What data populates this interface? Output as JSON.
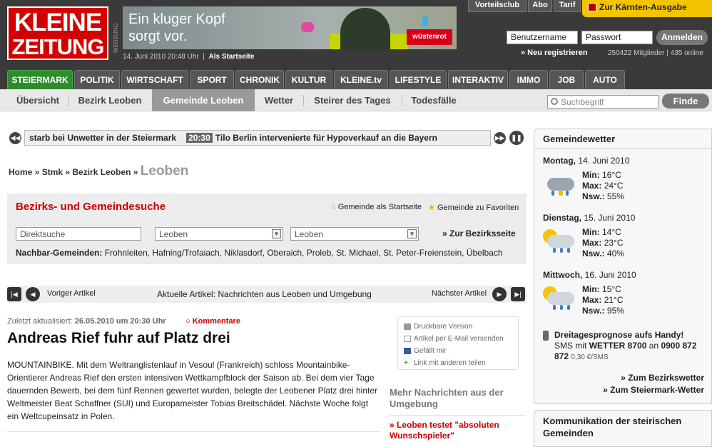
{
  "header": {
    "logo": [
      "KLEINE",
      "ZEITUNG"
    ],
    "werbung": "WERBUNG",
    "banner": {
      "line1": "Ein kluger Kopf",
      "line2": "sorgt vor.",
      "brand": "wüstenrot"
    },
    "date": "14. Juni 2010 20:48 Uhr",
    "startpage": "Als Startseite",
    "top_links": [
      "Vorteilsclub",
      "Abo",
      "Tarif"
    ],
    "kaernten": "Zur Kärnten-Ausgabe",
    "username_placeholder": "Benutzername",
    "password_placeholder": "Passwort",
    "login_button": "Anmelden",
    "register": "» Neu registrieren",
    "members": "250422 Mitglieder | 435 online"
  },
  "nav": {
    "tabs": [
      "STEIERMARK",
      "POLITIK",
      "WIRTSCHAFT",
      "SPORT",
      "CHRONIK",
      "KULTUR",
      "KLEINE.tv",
      "LIFESTYLE",
      "INTERAKTIV",
      "IMMO",
      "JOB",
      "AUTO"
    ]
  },
  "subnav": {
    "items": [
      "Übersicht",
      "Bezirk Leoben",
      "Gemeinde Leoben",
      "Wetter",
      "Steirer des Tages",
      "Todesfälle"
    ],
    "search_placeholder": "Suchbegriff",
    "search_button": "Finde"
  },
  "ticker": {
    "text1": "starb bei Unwetter in der Steiermark",
    "time": "20:30",
    "text2": "Tilo Berlin intervenierte für Hypoverkauf an die Bayern"
  },
  "breadcrumb": {
    "items": [
      "Home",
      "Stmk",
      "Bezirk Leoben"
    ],
    "current": "Leoben"
  },
  "suche": {
    "title": "Bezirks- und Gemeindesuche",
    "startseite": "Gemeinde als Startseite",
    "favoriten": "Gemeinde zu Favoriten",
    "direkt_placeholder": "Direktsuche",
    "select1": "Leoben",
    "select2": "Leoben",
    "bezirk_link": "» Zur Bezirksseite",
    "nachbar_label": "Nachbar-Gemeinden:",
    "nachbar": "Frohnleiten, Hafning/Trofaiach, Niklasdorf, Oberaich, Proleb, St. Michael, St. Peter-Freienstein, Übelbach"
  },
  "artnav": {
    "prev": "Voriger Artikel",
    "current": "Aktuelle Artikel: Nachrichten aus Leoben und Umgebung",
    "next": "Nächster Artikel"
  },
  "article": {
    "updated_label": "Zuletzt aktualisiert:",
    "updated": "26.05.2010 um 20:30 Uhr",
    "comments": "Kommentare",
    "headline": "Andreas Rief fuhr auf Platz drei",
    "body": "MOUNTAINBIKE. Mit dem Weltranglistenlauf in Vesoul (Frankreich) schloss Mountainbike-Orientierer Andreas Rief den ersten intensiven Wettkampfblock der Saison ab. Bei dem vier Tage dauernden Bewerb, bei dem fünf Rennen gewertet wurden, belegte der Leobener Platz drei hinter Weltmeister Beat Schaffner (SUI) und Europameister Tobias Breitschädel. Nächste Woche folgt ein Weltcupeinsatz in Polen."
  },
  "tools": [
    "Druckbare Version",
    "Artikel per E-Mail versenden",
    "Gefällt mir",
    "Link mit anderen teilen"
  ],
  "mehr": {
    "title": "Mehr Nachrichten aus der Umgebung",
    "item1": "» Leoben testet \"absoluten Wunschspieler\""
  },
  "wetter": {
    "title": "Gemeindewetter",
    "days": [
      {
        "day": "Montag,",
        "date": "14. Juni 2010",
        "min": "16°C",
        "max": "24°C",
        "nsw": "55%"
      },
      {
        "day": "Dienstag,",
        "date": "15. Juni 2010",
        "min": "14°C",
        "max": "23°C",
        "nsw": "40%"
      },
      {
        "day": "Mittwoch,",
        "date": "16. Juni 2010",
        "min": "15°C",
        "max": "21°C",
        "nsw": "95%"
      }
    ],
    "labels": {
      "min": "Min:",
      "max": "Max:",
      "nsw": "Nsw.:"
    },
    "sms_title": "Dreitagesprognose aufs Handy!",
    "sms_text1": "SMS mit",
    "sms_code": "WETTER 8700",
    "sms_text2": "an",
    "sms_number": "0900 872 872",
    "sms_price": "0,30 €/SMS",
    "link1": "» Zum Bezirkswetter",
    "link2": "» Zum Steiermark-Wetter"
  },
  "komm": {
    "title": "Kommunikation der steirischen Gemeinden"
  }
}
